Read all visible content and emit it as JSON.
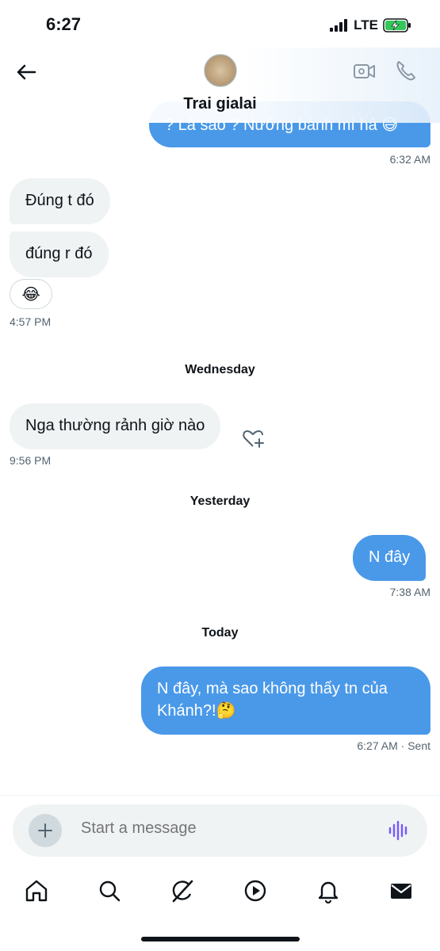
{
  "status_bar": {
    "time": "6:27",
    "network": "LTE"
  },
  "header": {
    "contact_name": "Trai gialai"
  },
  "messages": [
    {
      "text": "? Là sao ? Nướng bánh mì hả 😅",
      "direction": "out",
      "time": "6:32 AM"
    },
    {
      "text": "Đúng t đó",
      "direction": "in"
    },
    {
      "text": "đúng r đó",
      "direction": "in",
      "reaction": "😂",
      "time": "4:57 PM"
    },
    {
      "day": "Wednesday"
    },
    {
      "text": "Nga thường rảnh giờ nào",
      "direction": "in",
      "time": "9:56 PM"
    },
    {
      "day": "Yesterday"
    },
    {
      "text": "N đây",
      "direction": "out",
      "time": "7:38 AM"
    },
    {
      "day": "Today"
    },
    {
      "text": "N đây, mà sao không thấy tn của Khánh?!🤔",
      "direction": "out",
      "time": "6:27 AM",
      "status": "· Sent"
    }
  ],
  "composer": {
    "placeholder": "Start a message"
  },
  "nav": [
    "home-icon",
    "search-icon",
    "grok-icon",
    "video-icon",
    "notifications-icon",
    "messages-icon"
  ],
  "colors": {
    "accent": "#4a99e9",
    "bubble_in": "#eff3f4",
    "text_muted": "#536471"
  }
}
